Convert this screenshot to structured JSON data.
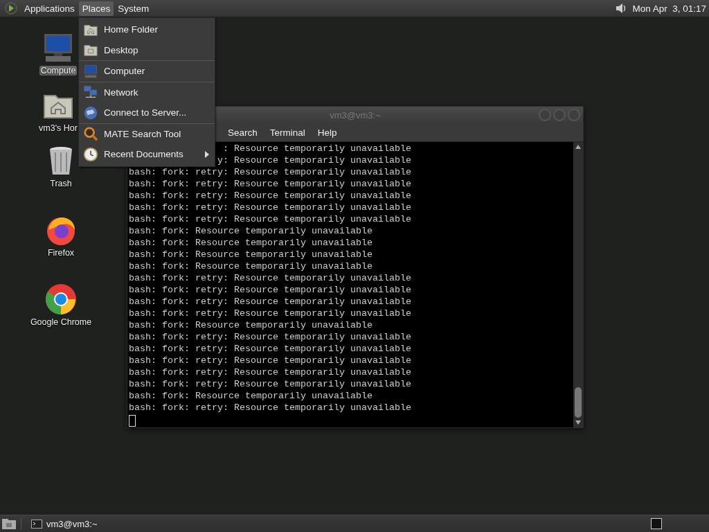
{
  "top_panel": {
    "menus": [
      {
        "label": "Applications",
        "selected": false
      },
      {
        "label": "Places",
        "selected": true
      },
      {
        "label": "System",
        "selected": false
      }
    ],
    "clock": "Mon Apr  3, 01:17"
  },
  "desktop_icons": [
    {
      "kind": "computer",
      "label": "Compute"
    },
    {
      "kind": "home",
      "label": "vm3's Hor"
    },
    {
      "kind": "trash",
      "label": "Trash"
    },
    {
      "kind": "firefox",
      "label": "Firefox"
    },
    {
      "kind": "chrome",
      "label": "Google Chrome"
    }
  ],
  "places_menu": {
    "sections": [
      [
        {
          "kind": "home",
          "label": "Home Folder",
          "has_submenu": false
        },
        {
          "kind": "desktop",
          "label": "Desktop",
          "has_submenu": false
        }
      ],
      [
        {
          "kind": "computer",
          "label": "Computer",
          "has_submenu": false
        }
      ],
      [
        {
          "kind": "network",
          "label": "Network",
          "has_submenu": false
        },
        {
          "kind": "globe",
          "label": "Connect to Server...",
          "has_submenu": false
        }
      ],
      [
        {
          "kind": "search",
          "label": "MATE Search Tool",
          "has_submenu": false
        },
        {
          "kind": "clock",
          "label": "Recent Documents",
          "has_submenu": true
        }
      ]
    ]
  },
  "terminal_window": {
    "title": "vm3@vm3:~",
    "menus": [
      "Search",
      "Terminal",
      "Help"
    ],
    "lines": [
      {
        "kind": "clipped",
        "text": ": Resource temporarily unavailable"
      },
      {
        "kind": "clipped",
        "text": "y: Resource temporarily unavailable"
      },
      {
        "kind": "full",
        "text": "bash: fork: retry: Resource temporarily unavailable"
      },
      {
        "kind": "full",
        "text": "bash: fork: retry: Resource temporarily unavailable"
      },
      {
        "kind": "full",
        "text": "bash: fork: retry: Resource temporarily unavailable"
      },
      {
        "kind": "full",
        "text": "bash: fork: retry: Resource temporarily unavailable"
      },
      {
        "kind": "full",
        "text": "bash: fork: retry: Resource temporarily unavailable"
      },
      {
        "kind": "full",
        "text": "bash: fork: Resource temporarily unavailable"
      },
      {
        "kind": "full",
        "text": "bash: fork: Resource temporarily unavailable"
      },
      {
        "kind": "full",
        "text": "bash: fork: Resource temporarily unavailable"
      },
      {
        "kind": "full",
        "text": "bash: fork: Resource temporarily unavailable"
      },
      {
        "kind": "full",
        "text": "bash: fork: retry: Resource temporarily unavailable"
      },
      {
        "kind": "full",
        "text": "bash: fork: retry: Resource temporarily unavailable"
      },
      {
        "kind": "full",
        "text": "bash: fork: retry: Resource temporarily unavailable"
      },
      {
        "kind": "full",
        "text": "bash: fork: retry: Resource temporarily unavailable"
      },
      {
        "kind": "full",
        "text": "bash: fork: Resource temporarily unavailable"
      },
      {
        "kind": "full",
        "text": "bash: fork: retry: Resource temporarily unavailable"
      },
      {
        "kind": "full",
        "text": "bash: fork: retry: Resource temporarily unavailable"
      },
      {
        "kind": "full",
        "text": "bash: fork: retry: Resource temporarily unavailable"
      },
      {
        "kind": "full",
        "text": "bash: fork: retry: Resource temporarily unavailable"
      },
      {
        "kind": "full",
        "text": "bash: fork: retry: Resource temporarily unavailable"
      },
      {
        "kind": "full",
        "text": "bash: fork: Resource temporarily unavailable"
      },
      {
        "kind": "full",
        "text": "bash: fork: retry: Resource temporarily unavailable"
      }
    ]
  },
  "bottom_panel": {
    "tasks": [
      {
        "label": "vm3@vm3:~"
      }
    ]
  }
}
